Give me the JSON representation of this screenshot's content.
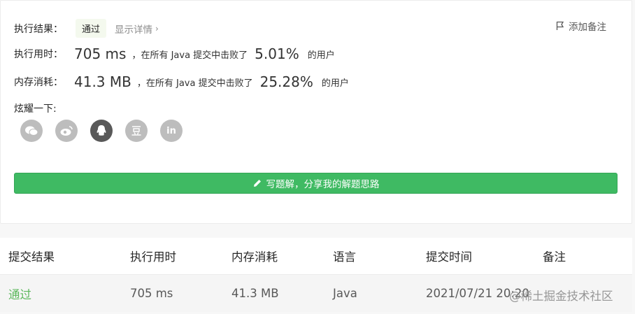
{
  "result": {
    "label": "执行结果：",
    "status": "通过",
    "detail_link": "显示详情",
    "add_note": "添加备注"
  },
  "runtime": {
    "label": "执行用时：",
    "value": "705 ms",
    "beat_text": "，在所有 Java 提交中击败了",
    "percent": "5.01%",
    "users": "的用户"
  },
  "memory": {
    "label": "内存消耗：",
    "value": "41.3 MB",
    "beat_text": "，在所有 Java 提交中击败了",
    "percent": "25.28%",
    "users": "的用户"
  },
  "share": {
    "label": "炫耀一下:",
    "icons": [
      "wechat-icon",
      "weibo-icon",
      "qq-icon",
      "douban-icon",
      "linkedin-icon"
    ],
    "linkedin_text": "in"
  },
  "cta_button": "写题解，分享我的解题思路",
  "table": {
    "headers": [
      "提交结果",
      "执行用时",
      "内存消耗",
      "语言",
      "提交时间",
      "备注"
    ],
    "rows": [
      [
        "通过",
        "705 ms",
        "41.3 MB",
        "Java",
        "2021/07/21 20:20",
        ""
      ]
    ]
  },
  "watermark": "@稀土掘金技术社区",
  "colors": {
    "accent_green": "#3fba63",
    "pass_green": "#5cb85c"
  }
}
